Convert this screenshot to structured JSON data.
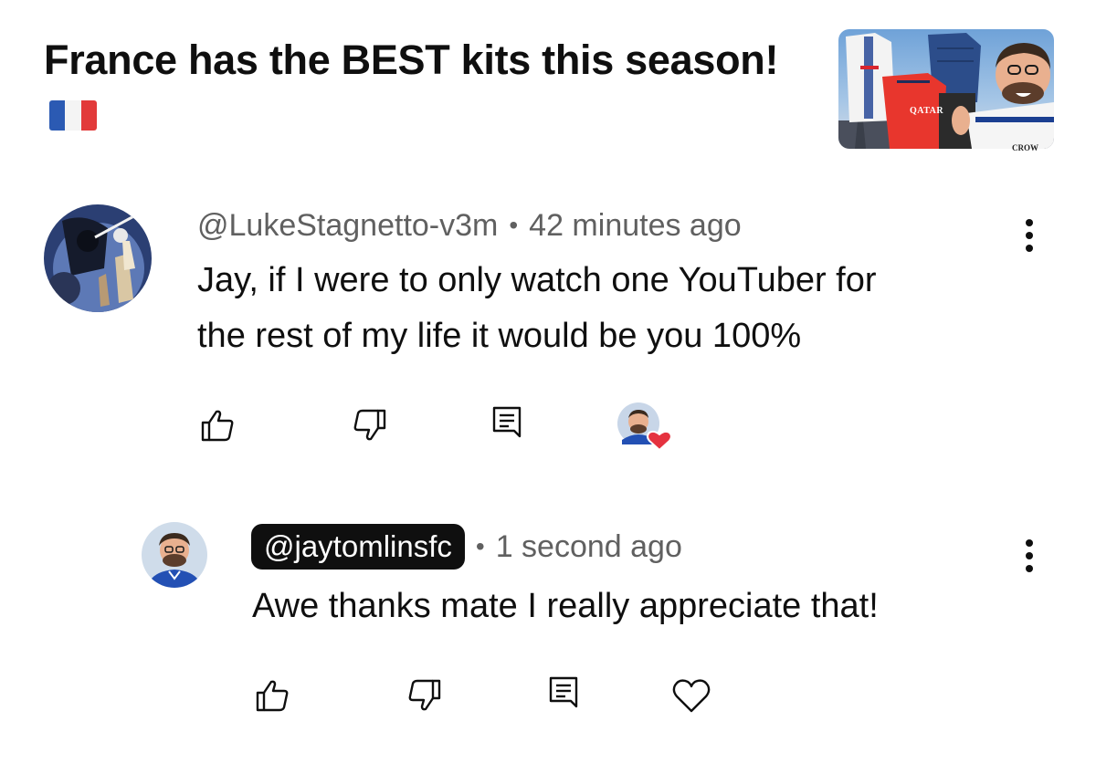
{
  "video": {
    "title": "France has the BEST kits this season!",
    "flag_icon": "france-flag-emoji",
    "thumbnail_text_1": "QATAR",
    "thumbnail_text_2": "CROW"
  },
  "comment": {
    "author": "@LukeStagnetto-v3m",
    "separator": "•",
    "time": "42 minutes ago",
    "text_line1": "Jay, if I were to only watch one YouTuber for",
    "text_line2": "the rest of my life it would be you 100%",
    "icons": [
      "like-icon",
      "dislike-icon",
      "reply-icon",
      "creator-heart-icon",
      "more-vert-icon"
    ]
  },
  "reply": {
    "author": "@jaytomlinsfc",
    "separator": "•",
    "time": "1 second ago",
    "text": "Awe thanks mate I really appreciate that!",
    "icons": [
      "like-icon",
      "dislike-icon",
      "reply-icon",
      "heart-icon",
      "more-vert-icon"
    ]
  },
  "colors": {
    "text_primary": "#0f0f0f",
    "text_secondary": "#606060",
    "heart_red": "#e5323f",
    "chip_bg": "#0f0f0f"
  }
}
